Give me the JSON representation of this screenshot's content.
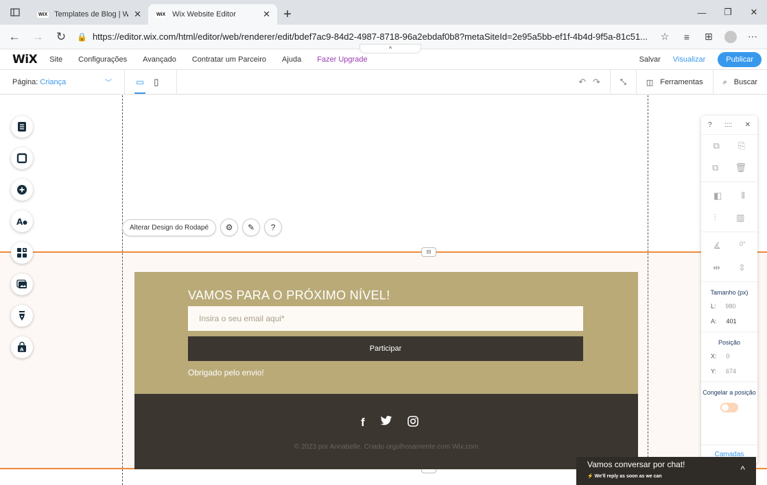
{
  "browser": {
    "tabs": [
      {
        "favicon": "WiX",
        "title": "Templates de Blog | Wix.com",
        "close": "✕"
      },
      {
        "favicon": "WiX",
        "title": "Wix Website Editor",
        "close": "✕"
      }
    ],
    "new_tab": "+",
    "url": "https://editor.wix.com/html/editor/web/renderer/edit/bdef7ac9-84d2-4987-8718-96a2ebdaf0b8?metaSiteId=2e95a5bb-ef1f-4b4d-9f5a-81c51...",
    "window_controls": [
      "—",
      "❐",
      "✕"
    ]
  },
  "wix_topbar": {
    "logo": "WiX",
    "menu": [
      "Site",
      "Configurações",
      "Avançado",
      "Contratar um Parceiro",
      "Ajuda"
    ],
    "upgrade": "Fazer Upgrade",
    "collapse_notch": "^",
    "save": "Salvar",
    "preview": "Visualizar",
    "publish": "Publicar"
  },
  "pagebar": {
    "page_label": "Página:",
    "page_name": "Criança",
    "tools_label": "Ferramentas",
    "search_label": "Buscar"
  },
  "context": {
    "change_footer": "Alterar Design do Rodapé"
  },
  "newsletter": {
    "title": "VAMOS PARA O PRÓXIMO NÍVEL!",
    "email_placeholder": "Insira o seu email aqui*",
    "button": "Participar",
    "thanks": "Obrigado pelo envio!"
  },
  "footer": {
    "copyright": "© 2023 por Annabelle. Criado orgulhosamente com Wix.com"
  },
  "inspector": {
    "help": "?",
    "drag": "::::",
    "close": "✕",
    "rotation": "0°",
    "size_label": "Tamanho (px)",
    "width_key": "L:",
    "width_val": "980",
    "height_key": "A:",
    "height_val": "401",
    "position_label": "Posição",
    "x_key": "X:",
    "x_val": "0",
    "y_key": "Y:",
    "y_val": "674",
    "freeze_label": "Congelar a posição",
    "layers": "Camadas"
  },
  "chat": {
    "title": "Vamos conversar por chat!",
    "subtitle": "We'll reply as soon as we can",
    "collapse": "^"
  },
  "colors": {
    "accent": "#3899ec",
    "upgrade": "#9a3bb4",
    "section_border": "#f08a3a",
    "newsletter_bg": "#b9aa78",
    "footer_bg": "#3b3630"
  }
}
